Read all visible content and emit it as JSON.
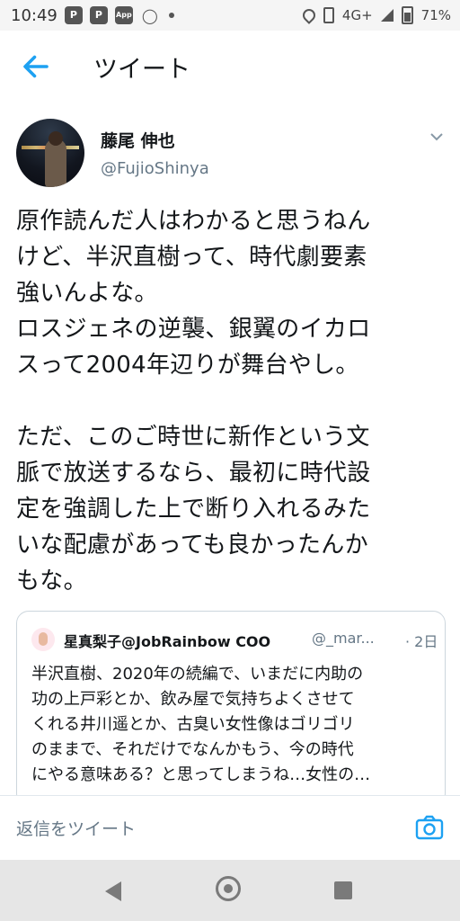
{
  "status_bar": {
    "time": "10:49",
    "icons": [
      "p-icon",
      "p-icon",
      "app-icon",
      "bulb-icon",
      "dot"
    ],
    "app_badge": "App",
    "right": {
      "network": "4G+",
      "battery": "71%"
    }
  },
  "header": {
    "title": "ツイート",
    "back_icon": "arrow-left-icon"
  },
  "author": {
    "name": "藤尾 伸也",
    "handle": "@FujioShinya"
  },
  "tweet": {
    "text": "原作読んだ人はわかると思うねん\nけど、半沢直樹って、時代劇要素\n強いんよな。\nロスジェネの逆襲、銀翼のイカロ\nスって2004年辺りが舞台やし。\n\nただ、このご時世に新作という文\n脈で放送するなら、最初に時代設\n定を強調した上で断り入れるみた\nいな配慮があっても良かったんか\nもな。"
  },
  "quoted_tweet": {
    "name": "星真梨子@JobRainbow COO",
    "handle": "@_mar...",
    "time": "· 2日",
    "text": "半沢直樹、2020年の続編で、いまだに内助の\n功の上戸彩とか、飲み屋で気持ちよくさせて\nくれる井川遥とか、古臭い女性像はゴリゴリ\nのままで、それだけでなんかもう、今の時代\nにやる意味ある？と思ってしまうね…女性の…"
  },
  "reply_bar": {
    "placeholder": "返信をツイート",
    "camera_icon": "camera-icon"
  },
  "colors": {
    "accent": "#1da1f2",
    "text": "#14171a",
    "muted": "#657786",
    "border": "#ccd6dd"
  }
}
